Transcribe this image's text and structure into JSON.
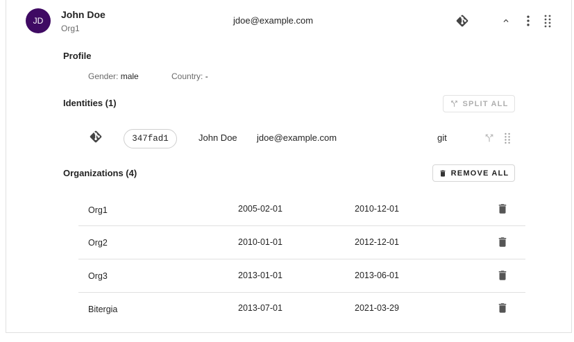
{
  "header": {
    "avatar_initials": "JD",
    "name": "John Doe",
    "organization": "Org1",
    "email": "jdoe@example.com",
    "source_icon": "git-diamond-icon",
    "collapse_icon": "chevron-up-icon",
    "menu_icon": "more-vert-icon",
    "drag_icon": "drag-handle-icon",
    "avatar_color": "#3f0a63"
  },
  "profile": {
    "title": "Profile",
    "gender_label": "Gender:",
    "gender_value": "male",
    "country_label": "Country:",
    "country_value": "-"
  },
  "identities": {
    "title": "Identities (1)",
    "split_all_label": "SPLIT ALL",
    "items": [
      {
        "uuid": "347fad1",
        "name": "John Doe",
        "email": "jdoe@example.com",
        "source": "git"
      }
    ]
  },
  "organizations": {
    "title": "Organizations (4)",
    "remove_all_label": "REMOVE ALL",
    "rows": [
      {
        "name": "Org1",
        "start": "2005-02-01",
        "end": "2010-12-01"
      },
      {
        "name": "Org2",
        "start": "2010-01-01",
        "end": "2012-12-01"
      },
      {
        "name": "Org3",
        "start": "2013-01-01",
        "end": "2013-06-01"
      },
      {
        "name": "Bitergia",
        "start": "2013-07-01",
        "end": "2021-03-29"
      }
    ]
  }
}
